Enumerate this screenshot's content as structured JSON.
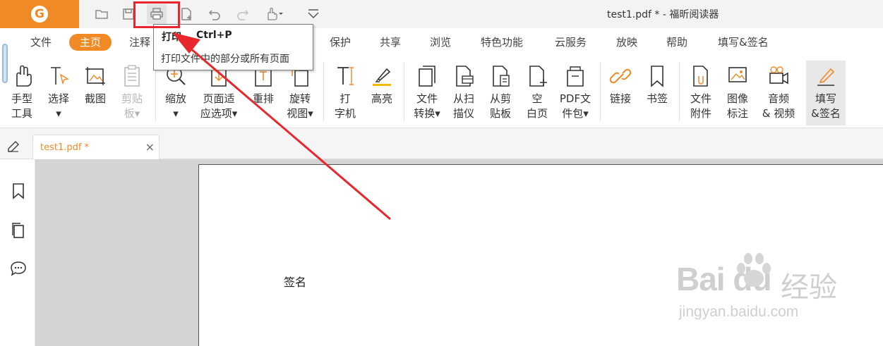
{
  "app": {
    "logo_text": "G",
    "window_title": "test1.pdf * - 福昕阅读器",
    "accent_color": "#f08a24"
  },
  "quick_access": {
    "icons": [
      "folder-open-icon",
      "save-icon",
      "print-icon",
      "new-doc-icon",
      "undo-icon",
      "redo-icon",
      "hand-tool-icon",
      "customize-dropdown-icon"
    ]
  },
  "menu": {
    "items": [
      "文件",
      "主页",
      "注释",
      "保护",
      "共享",
      "浏览",
      "特色功能",
      "云服务",
      "放映",
      "帮助",
      "填写&签名"
    ],
    "active": "主页"
  },
  "ribbon": {
    "buttons": [
      {
        "label": "手型\n工具",
        "icon": "hand-icon"
      },
      {
        "label": "选择\n▾",
        "icon": "select-text-icon"
      },
      {
        "label": "截图",
        "icon": "snapshot-icon"
      },
      {
        "label": "剪贴\n板▾",
        "icon": "clipboard-icon"
      },
      {
        "label": "缩放\n▾",
        "icon": "zoom-icon"
      },
      {
        "label": "页面适\n应选项▾",
        "icon": "page-fit-icon"
      },
      {
        "label": "重排",
        "icon": "reflow-icon"
      },
      {
        "label": "旋转\n视图▾",
        "icon": "rotate-icon"
      },
      {
        "label": "打\n字机",
        "icon": "typewriter-icon"
      },
      {
        "label": "高亮",
        "icon": "highlight-icon"
      },
      {
        "label": "文件\n转换▾",
        "icon": "file-convert-icon"
      },
      {
        "label": "从扫\n描仪",
        "icon": "scanner-icon"
      },
      {
        "label": "从剪\n贴板",
        "icon": "from-clipboard-icon"
      },
      {
        "label": "空\n白页",
        "icon": "blank-page-icon"
      },
      {
        "label": "PDF文\n件包▾",
        "icon": "pdf-portfolio-icon"
      },
      {
        "label": "链接",
        "icon": "link-icon"
      },
      {
        "label": "书签",
        "icon": "bookmark-icon"
      },
      {
        "label": "文件\n附件",
        "icon": "attachment-icon"
      },
      {
        "label": "图像\n标注",
        "icon": "image-annotation-icon"
      },
      {
        "label": "音频\n& 视频",
        "icon": "audio-video-icon"
      },
      {
        "label": "填写\n&签名",
        "icon": "fill-sign-icon"
      }
    ]
  },
  "tooltip": {
    "title": "打印",
    "shortcut": "Ctrl+P",
    "description": "打印文件中的部分或所有页面"
  },
  "document": {
    "tab_label": "test1.pdf *",
    "close_glyph": "×",
    "page_text": "签名"
  },
  "sidebar": {
    "icons": [
      "bookmark-panel-icon",
      "pages-panel-icon",
      "comments-panel-icon"
    ]
  },
  "watermark": {
    "brand": "Bai du",
    "chinese": "经验",
    "url": "jingyan.baidu.com"
  },
  "annotation": {
    "color": "#e8262b"
  }
}
